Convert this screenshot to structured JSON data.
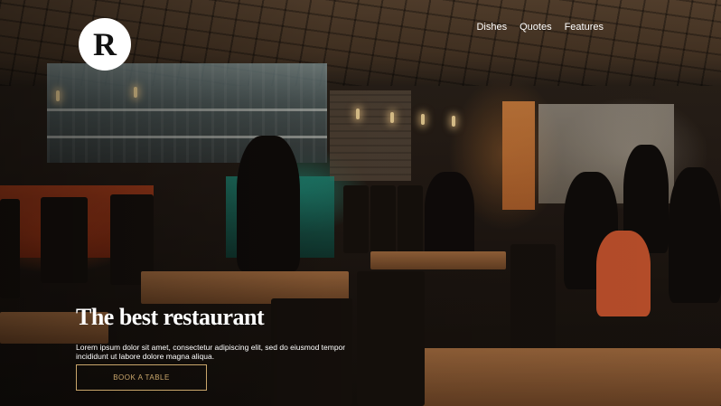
{
  "brand": {
    "logo_letter": "R"
  },
  "nav": {
    "items": [
      {
        "label": "Dishes"
      },
      {
        "label": "Quotes"
      },
      {
        "label": "Features"
      }
    ]
  },
  "hero": {
    "headline": "The best restaurant",
    "lead": "Lorem ipsum dolor sit amet, consectetur adipiscing elit, sed do eiusmod tempor incididunt ut labore dolore magna aliqua.",
    "cta_label": "BOOK A TABLE"
  },
  "colors": {
    "accent": "#c9a66b",
    "text": "#ffffff",
    "logo_bg": "#ffffff"
  }
}
